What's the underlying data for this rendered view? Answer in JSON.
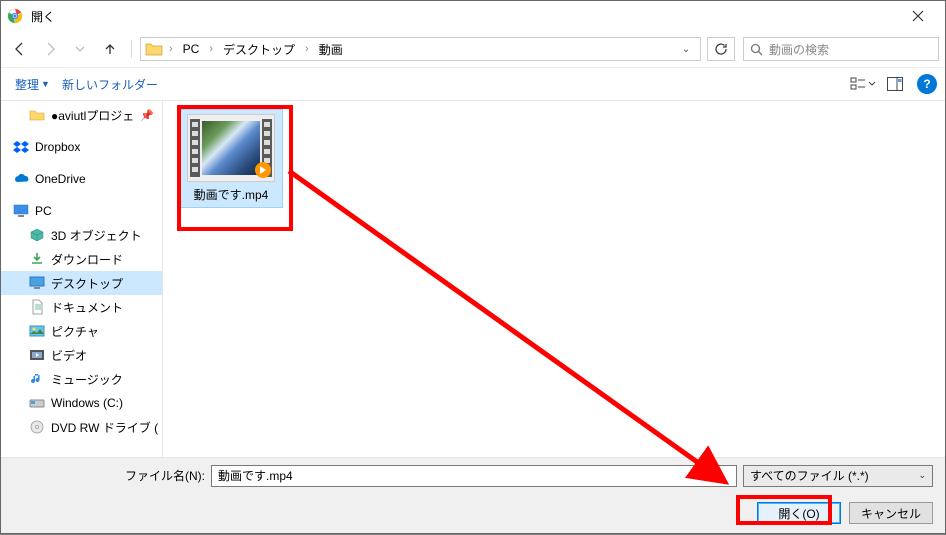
{
  "title": "開く",
  "breadcrumb": {
    "root": "PC",
    "mid": "デスクトップ",
    "leaf": "動画"
  },
  "search": {
    "placeholder": "動画の検索"
  },
  "toolbar": {
    "organize": "整理",
    "newFolder": "新しいフォルダー"
  },
  "tree": {
    "aviutl": "●aviutlプロジェ",
    "dropbox": "Dropbox",
    "onedrive": "OneDrive",
    "pc": "PC",
    "threeDObjects": "3D オブジェクト",
    "downloads": "ダウンロード",
    "desktop": "デスクトップ",
    "documents": "ドキュメント",
    "pictures": "ピクチャ",
    "videos": "ビデオ",
    "music": "ミュージック",
    "winC": "Windows (C:)",
    "dvd": "DVD RW ドライブ ("
  },
  "file": {
    "name": "動画です.mp4"
  },
  "fileNameLabel": "ファイル名(N):",
  "fileNameValue": "動画です.mp4",
  "fileType": "すべてのファイル (*.*)",
  "buttons": {
    "open": "開く(O)",
    "cancel": "キャンセル"
  }
}
